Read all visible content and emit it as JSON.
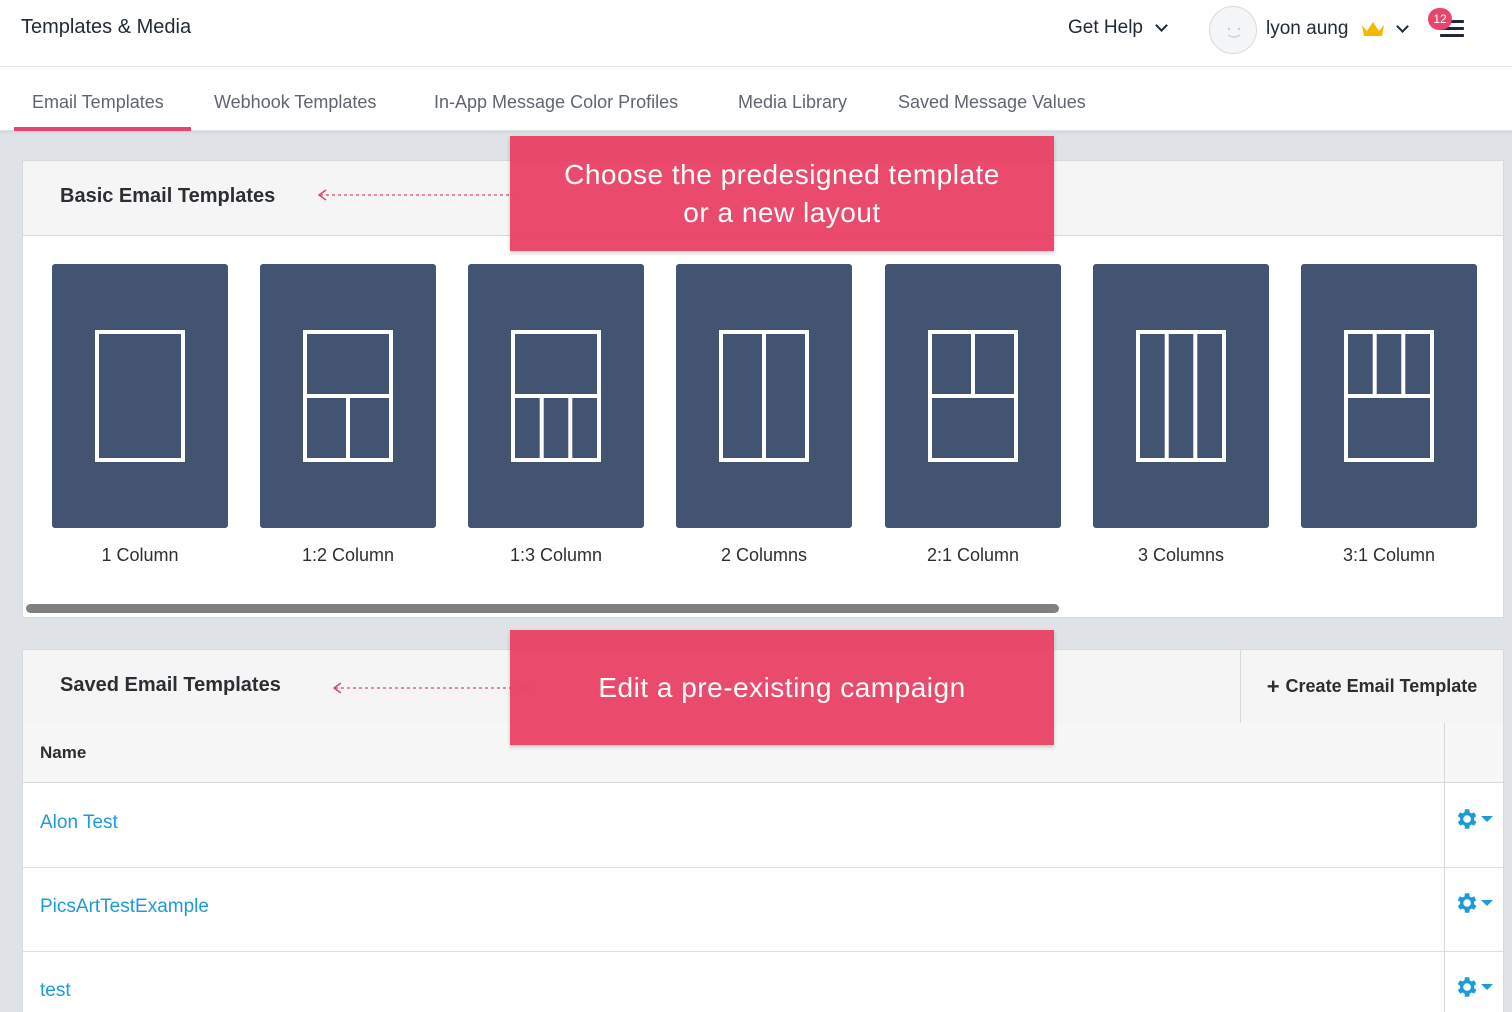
{
  "header": {
    "title": "Templates & Media",
    "help_label": "Get Help",
    "user_name": "lyon aung",
    "notification_count": "12"
  },
  "tabs": [
    {
      "label": "Email Templates",
      "active": true
    },
    {
      "label": "Webhook Templates",
      "active": false
    },
    {
      "label": "In-App Message Color Profiles",
      "active": false
    },
    {
      "label": "Media Library",
      "active": false
    },
    {
      "label": "Saved Message Values",
      "active": false
    }
  ],
  "basic_templates": {
    "title": "Basic Email Templates",
    "items": [
      {
        "label": "1 Column",
        "icon": "layout-1-column-icon"
      },
      {
        "label": "1:2 Column",
        "icon": "layout-1-2-column-icon"
      },
      {
        "label": "1:3 Column",
        "icon": "layout-1-3-column-icon"
      },
      {
        "label": "2 Columns",
        "icon": "layout-2-columns-icon"
      },
      {
        "label": "2:1 Column",
        "icon": "layout-2-1-column-icon"
      },
      {
        "label": "3 Columns",
        "icon": "layout-3-columns-icon"
      },
      {
        "label": "3:1 Column",
        "icon": "layout-3-1-column-icon"
      }
    ]
  },
  "saved_templates": {
    "title": "Saved Email Templates",
    "create_label": "Create Email Template",
    "column_name": "Name",
    "rows": [
      "Alon Test",
      "PicsArtTestExample",
      "test"
    ]
  },
  "callouts": {
    "choose": "Choose the predesigned template or a new layout",
    "edit": "Edit a pre-existing campaign"
  },
  "colors": {
    "accent": "#e8456a",
    "card": "#435372",
    "link": "#1b9bd7",
    "crown": "#f5b800"
  }
}
